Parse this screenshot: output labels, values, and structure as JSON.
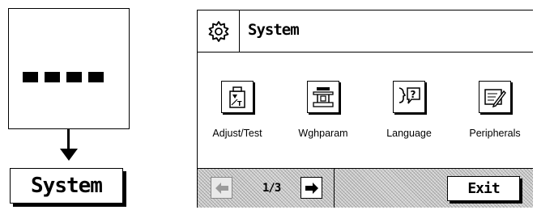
{
  "function_key": {
    "dots_icon": "four-square-dots"
  },
  "system_button": {
    "label": "System"
  },
  "screen": {
    "title": "System",
    "title_icon": "gear-icon",
    "items": [
      {
        "label": "Adjust/Test",
        "icon": "adjust-weight-icon"
      },
      {
        "label": "Wghparam",
        "icon": "balance-icon"
      },
      {
        "label": "Language",
        "icon": "language-face-icon"
      },
      {
        "label": "Peripherals",
        "icon": "printer-pen-icon"
      }
    ],
    "pager": {
      "page": "1/3"
    },
    "exit_label": "Exit"
  }
}
